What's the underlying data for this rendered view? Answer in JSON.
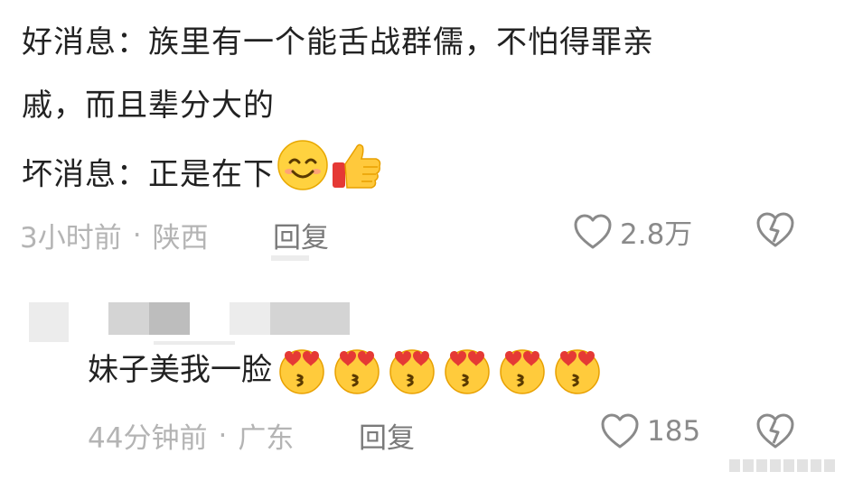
{
  "comments": [
    {
      "lines": [
        "好消息：族里有一个能舌战群儒，不怕得罪亲",
        "戚，而且辈分大的",
        "坏消息：正是在下"
      ],
      "inline_emojis": [
        "smiling-face-emoji",
        "thumbs-up-emoji"
      ],
      "time": "3小时前",
      "separator": "·",
      "location": "陕西",
      "reply_label": "回复",
      "likes": "2.8万"
    },
    {
      "text": "妹子美我一脸",
      "emoji_count": 6,
      "emoji_name": "face-blowing-kiss-heart-eyes-emoji",
      "time": "44分钟前",
      "separator": "·",
      "location": "广东",
      "reply_label": "回复",
      "likes": "185"
    }
  ],
  "colors": {
    "text": "#222222",
    "meta": "#b4b4b4",
    "reply": "#7a7a7a",
    "icon": "#8a8a8a"
  }
}
